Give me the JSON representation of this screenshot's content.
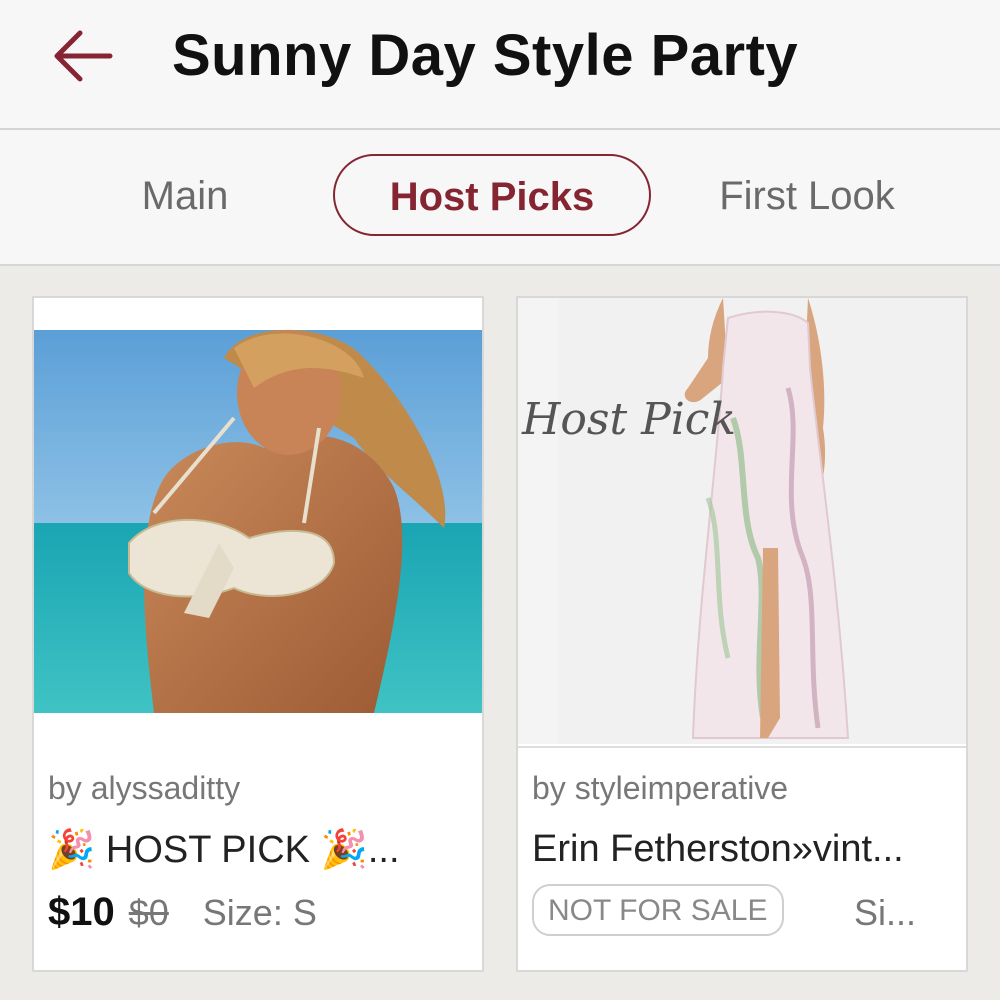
{
  "header": {
    "title": "Sunny Day Style Party",
    "back_icon": "arrow-left-icon",
    "accent": "#852532"
  },
  "tabs": [
    {
      "label": "Main"
    },
    {
      "label": "Host Picks",
      "active": true
    },
    {
      "label": "First Look"
    }
  ],
  "listings": [
    {
      "seller": "by alyssaditty",
      "title": "🎉 HOST PICK 🎉...",
      "price": "$10",
      "original_price": "$0",
      "size": "Size: S",
      "image": "model-in-white-bikini-photo"
    },
    {
      "seller": "by styleimperative",
      "title": "Erin Fetherston»vint...",
      "badge": "NOT FOR SALE",
      "size": "Si...",
      "image_overlay_text": "Host Pick",
      "image": "model-in-floral-maxi-dress-photo"
    }
  ]
}
